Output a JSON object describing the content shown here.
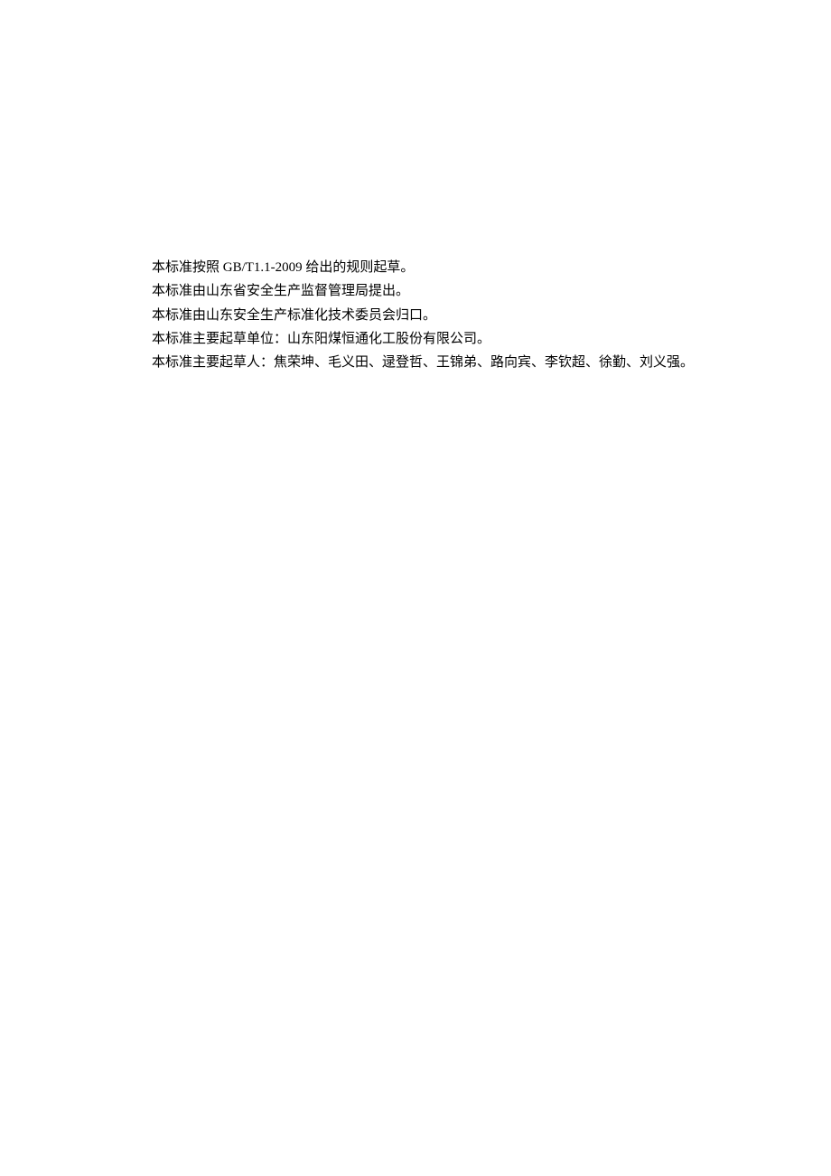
{
  "paragraphs": [
    "本标准按照 GB/T1.1-2009 给出的规则起草。",
    "本标准由山东省安全生产监督管理局提出。",
    "本标准由山东安全生产标准化技术委员会归口。",
    "本标准主要起草单位：山东阳煤恒通化工股份有限公司。",
    "本标准主要起草人：焦荣坤、毛义田、逯登哲、王锦弟、路向宾、李钦超、徐勤、刘义强。"
  ]
}
